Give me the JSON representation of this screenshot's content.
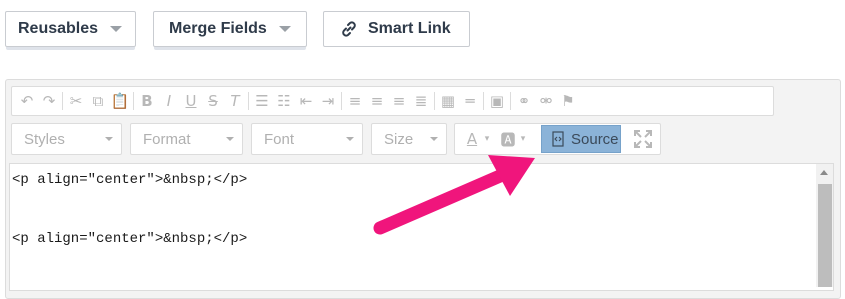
{
  "top_buttons": {
    "reusables_label": "Reusables",
    "merge_fields_label": "Merge Fields",
    "smart_link_label": "Smart Link"
  },
  "toolbar": {
    "row1_icons": [
      "undo-icon",
      "redo-icon",
      "cut-icon",
      "copy-icon",
      "paste-icon",
      "bold-icon",
      "italic-icon",
      "underline-icon",
      "strikethrough-icon",
      "remove-format-icon",
      "numbered-list-icon",
      "bulleted-list-icon",
      "decrease-indent-icon",
      "increase-indent-icon",
      "align-left-icon",
      "align-center-icon",
      "align-right-icon",
      "justify-icon",
      "table-icon",
      "horizontal-line-icon",
      "image-icon",
      "link-icon",
      "unlink-icon",
      "anchor-icon"
    ],
    "styles_label": "Styles",
    "format_label": "Format",
    "font_label": "Font",
    "size_label": "Size",
    "source_label": "Source"
  },
  "editor": {
    "lines": [
      "<p align=\"center\">&nbsp;</p>",
      "<p align=\"center\">&nbsp;</p>"
    ]
  },
  "colors": {
    "source_active": "#8bb3d8",
    "annotation_arrow": "#f0157c"
  }
}
